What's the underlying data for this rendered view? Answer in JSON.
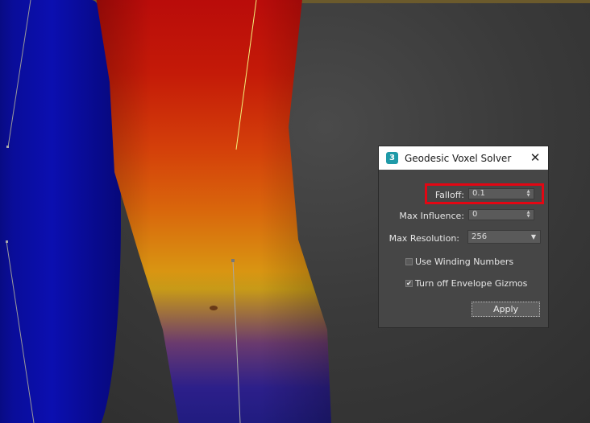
{
  "dialog": {
    "title": "Geodesic Voxel Solver",
    "app_icon_glyph": "3",
    "close_glyph": "✕",
    "falloff": {
      "label": "Falloff:",
      "value": "0.1"
    },
    "max_influence": {
      "label": "Max Influence:",
      "value": "0"
    },
    "max_resolution": {
      "label": "Max Resolution:",
      "value": "256"
    },
    "use_winding_numbers": {
      "label": "Use Winding Numbers",
      "checked": false
    },
    "turn_off_envelope_gizmos": {
      "label": "Turn off Envelope Gizmos",
      "checked": true,
      "check_glyph": "✔"
    },
    "apply_label": "Apply",
    "highlight_color": "#e30613"
  },
  "viewport": {
    "heatmap_colors": [
      "#0b0fb0",
      "#b80a0a",
      "#d9650c",
      "#d99512",
      "#2c1f8a"
    ]
  },
  "icons": {
    "app": "3ds-max-icon",
    "close": "close-icon",
    "spinner": "spinner-arrows-icon",
    "dropdown": "chevron-down-icon",
    "checkbox": "checkbox-icon"
  }
}
